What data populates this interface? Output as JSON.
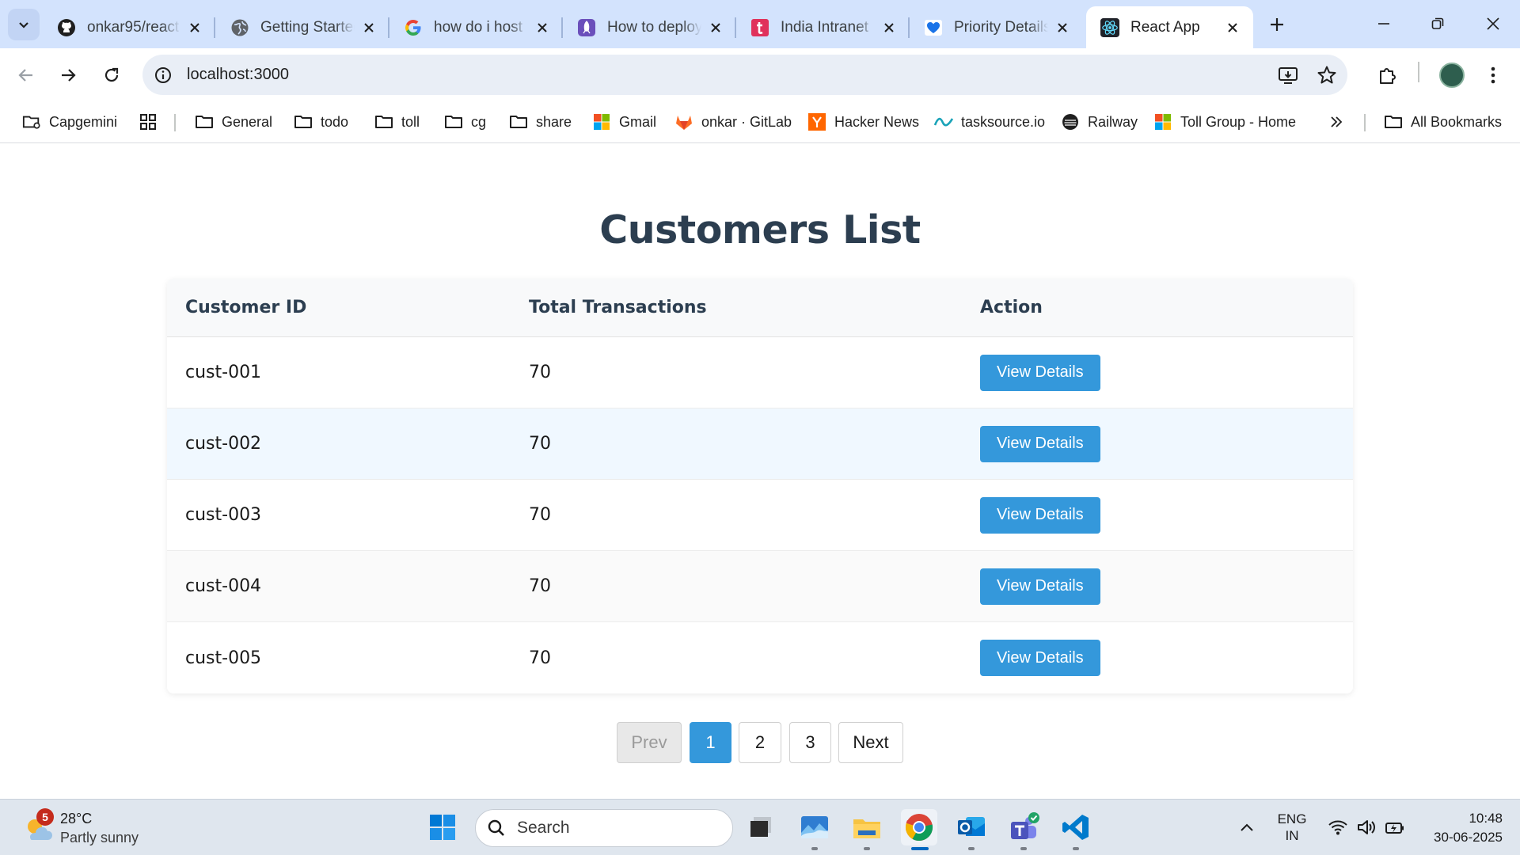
{
  "browser": {
    "tabs": [
      {
        "title": "onkar95/react",
        "icon": "github-icon"
      },
      {
        "title": "Getting Started",
        "icon": "globe-icon"
      },
      {
        "title": "how do i host",
        "icon": "google-icon"
      },
      {
        "title": "How to deploy",
        "icon": "rocket-icon"
      },
      {
        "title": "India Intranet",
        "icon": "intranet-icon"
      },
      {
        "title": "Priority Details",
        "icon": "heart-icon"
      },
      {
        "title": "React App",
        "icon": "react-icon",
        "active": true
      }
    ],
    "url": "localhost:3000",
    "bookmarks": [
      {
        "label": "Capgemini",
        "icon": "folder-gear-icon"
      },
      {
        "label": "",
        "icon": "apps-grid-icon"
      },
      {
        "label": "General",
        "icon": "folder-icon"
      },
      {
        "label": "todo",
        "icon": "folder-icon"
      },
      {
        "label": "toll",
        "icon": "folder-icon"
      },
      {
        "label": "cg",
        "icon": "folder-icon"
      },
      {
        "label": "share",
        "icon": "folder-icon"
      },
      {
        "label": "Gmail",
        "icon": "microsoft-icon"
      },
      {
        "label": "onkar · GitLab",
        "icon": "gitlab-icon"
      },
      {
        "label": "Hacker News",
        "icon": "hackernews-icon"
      },
      {
        "label": "tasksource.io",
        "icon": "tasksource-icon"
      },
      {
        "label": "Railway",
        "icon": "railway-icon"
      },
      {
        "label": "Toll Group - Home",
        "icon": "microsoft-icon"
      }
    ],
    "all_bookmarks": "All Bookmarks"
  },
  "page": {
    "title": "Customers List",
    "columns": [
      "Customer ID",
      "Total Transactions",
      "Action"
    ],
    "rows": [
      {
        "id": "cust-001",
        "transactions": "70",
        "action": "View Details"
      },
      {
        "id": "cust-002",
        "transactions": "70",
        "action": "View Details"
      },
      {
        "id": "cust-003",
        "transactions": "70",
        "action": "View Details"
      },
      {
        "id": "cust-004",
        "transactions": "70",
        "action": "View Details"
      },
      {
        "id": "cust-005",
        "transactions": "70",
        "action": "View Details"
      }
    ],
    "pagination": {
      "prev": "Prev",
      "pages": [
        "1",
        "2",
        "3"
      ],
      "current": "1",
      "next": "Next"
    }
  },
  "taskbar": {
    "weather_badge": "5",
    "temperature": "28°C",
    "condition": "Partly sunny",
    "search_placeholder": "Search",
    "lang_line1": "ENG",
    "lang_line2": "IN",
    "time": "10:48",
    "date": "30-06-2025"
  },
  "colors": {
    "accent": "#3498db",
    "title": "#2c3e50",
    "tabstrip": "#d3e3fd",
    "row_highlight": "#f0f8ff"
  }
}
